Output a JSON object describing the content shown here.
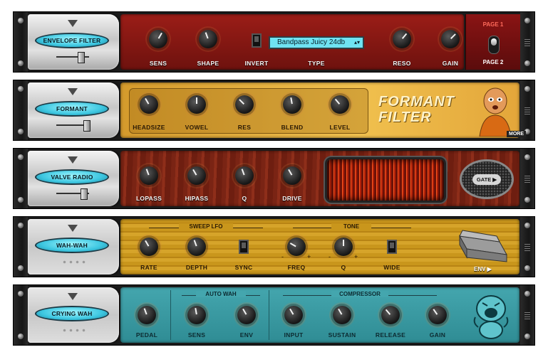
{
  "racks": {
    "envelope_filter": {
      "name": "ENVELOPE FILTER",
      "knobs": [
        "SENS",
        "SHAPE"
      ],
      "invert": "INVERT",
      "type_label": "TYPE",
      "type_value": "Bandpass Juicy 24db",
      "knobs2": [
        "RESO",
        "GAIN"
      ],
      "page1": "PAGE 1",
      "page2": "PAGE 2"
    },
    "formant": {
      "name": "FORMANT",
      "knobs": [
        "HEADSIZE",
        "VOWEL",
        "RES",
        "BLEND",
        "LEVEL"
      ],
      "title_line1": "FORMANT",
      "title_line2": "FILTER",
      "more": "MORE"
    },
    "valve_radio": {
      "name": "VALVE RADIO",
      "knobs": [
        "LOPASS",
        "HIPASS",
        "Q",
        "DRIVE"
      ],
      "gate": "GATE ▶"
    },
    "wah_wah": {
      "name": "WAH-WAH",
      "group1": "SWEEP LFO",
      "group2": "TONE",
      "knobs": [
        "RATE",
        "DEPTH"
      ],
      "sync": "SYNC",
      "knobs2": [
        "FREQ",
        "Q"
      ],
      "wide": "WIDE",
      "env": "ENV ▶",
      "minus": "-",
      "plus": "+"
    },
    "crying_wah": {
      "name": "CRYING WAH",
      "group1": "AUTO WAH",
      "group2": "COMPRESSOR",
      "knobs": [
        "PEDAL",
        "SENS",
        "ENV",
        "INPUT",
        "SUSTAIN",
        "RELEASE",
        "GAIN"
      ]
    }
  },
  "colors": {
    "red_panel": "#8e1a14",
    "gold_panel": "#d8a235",
    "wood_panel": "#8a2a1a",
    "wah_panel": "#c9961c",
    "teal_panel": "#3a9aa2",
    "pill": "#3cc6e0"
  },
  "icons": [
    "triangle-down-icon",
    "cartoon-monk-icon",
    "wah-pedal-icon",
    "crying-baby-icon"
  ]
}
